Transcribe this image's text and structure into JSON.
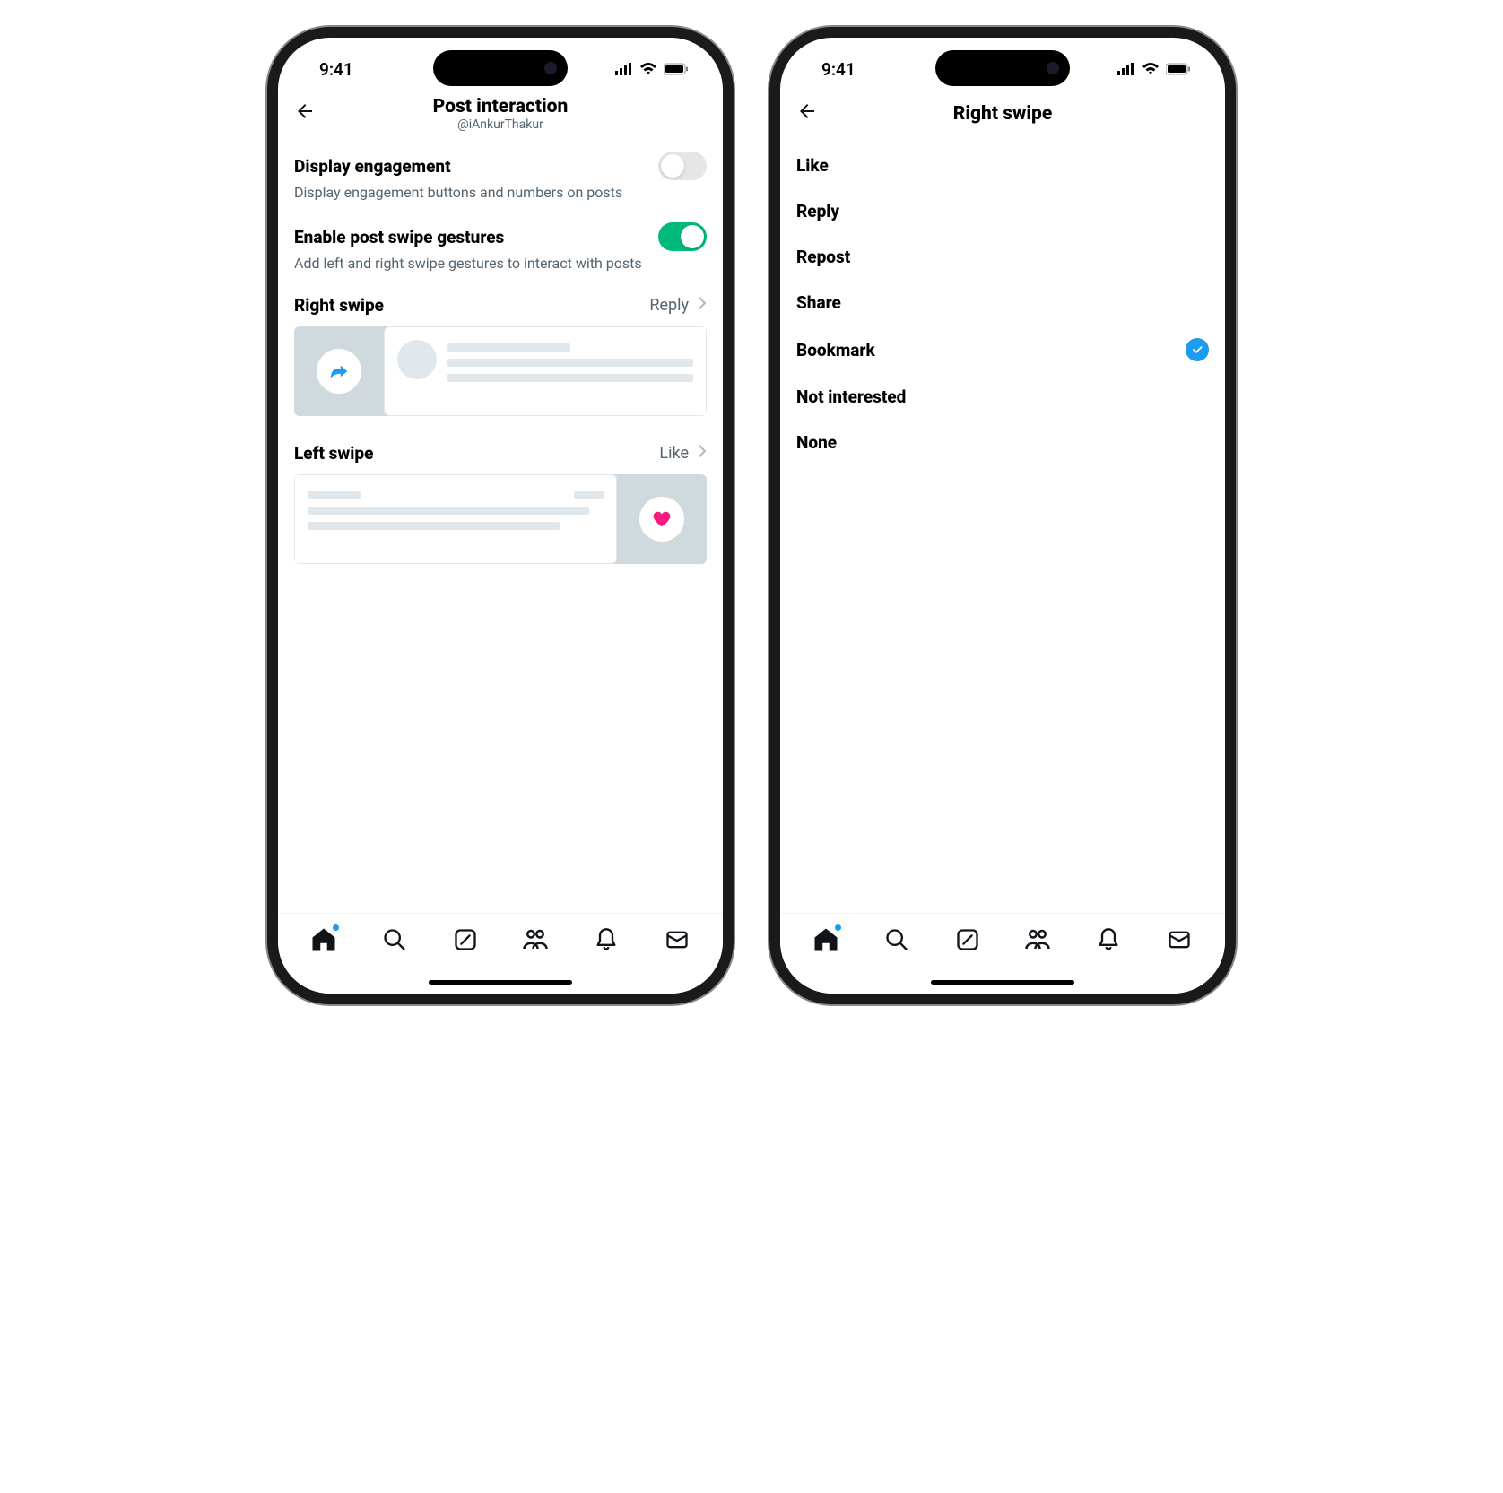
{
  "status": {
    "time": "9:41"
  },
  "left_screen": {
    "title": "Post interaction",
    "handle": "@iAnkurThakur",
    "display_engagement": {
      "label": "Display engagement",
      "desc": "Display engagement buttons and numbers on posts",
      "enabled": false
    },
    "enable_swipe": {
      "label": "Enable post swipe gestures",
      "desc": "Add left and right swipe gestures to interact with posts",
      "enabled": true
    },
    "right_swipe": {
      "label": "Right swipe",
      "value": "Reply"
    },
    "left_swipe": {
      "label": "Left swipe",
      "value": "Like"
    }
  },
  "right_screen": {
    "title": "Right swipe",
    "options": [
      {
        "label": "Like",
        "selected": false
      },
      {
        "label": "Reply",
        "selected": false
      },
      {
        "label": "Repost",
        "selected": false
      },
      {
        "label": "Share",
        "selected": false
      },
      {
        "label": "Bookmark",
        "selected": true
      },
      {
        "label": "Not interested",
        "selected": false
      },
      {
        "label": "None",
        "selected": false
      }
    ]
  }
}
